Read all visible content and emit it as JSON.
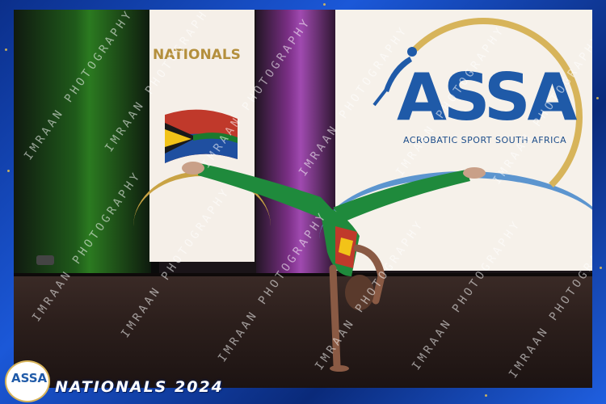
{
  "banner_left": {
    "text": "NATIONALS"
  },
  "banner_right": {
    "logo_text": "ASSA",
    "subtitle": "ACROBATIC SPORT SOUTH AFRICA"
  },
  "watermark": {
    "text": "IMRAAN PHOTOGRAPHY"
  },
  "footer": {
    "badge_text": "ASSA",
    "event_title": "NATIONALS 2024"
  },
  "colors": {
    "frame": "#1b58d8",
    "costume": "#1f8a3c",
    "logo_blue": "#1f5aa8",
    "gold": "#d7b45a"
  }
}
